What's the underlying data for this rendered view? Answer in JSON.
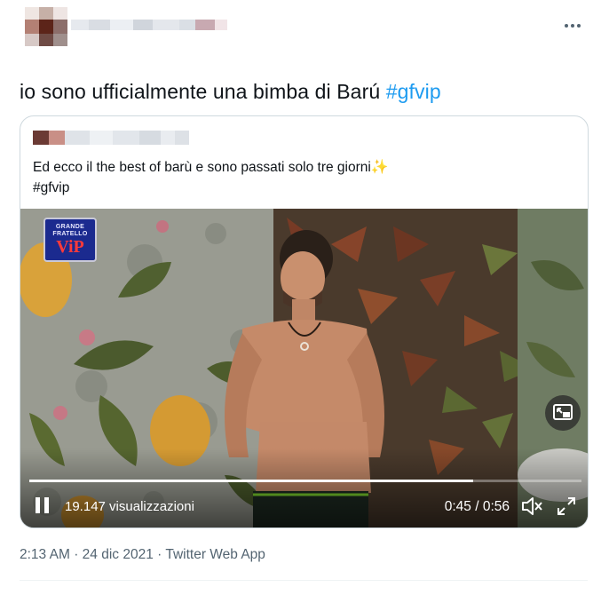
{
  "tweet": {
    "text_plain": "io sono ufficialmente una bimba di Barú",
    "hashtag": "#gfvip"
  },
  "quote": {
    "line1": "Ed ecco il the best of barù e sono passati solo tre giorni",
    "sparkle": "✨",
    "line2": "#gfvip"
  },
  "video": {
    "logo_small": "GRANDE FRATELLO",
    "logo_big": "ViP",
    "views": "19.147 visualizzazioni",
    "time": "0:45 / 0:56",
    "progress": 0.8036
  },
  "footer": {
    "time": "2:13 AM",
    "date": "24 dic 2021",
    "source": "Twitter Web App",
    "sep": "·"
  },
  "icons": {
    "more": "more-horizontal-icon",
    "pause": "pause-icon",
    "mute": "volume-muted-icon",
    "fullscreen": "fullscreen-icon",
    "pip": "picture-in-picture-icon"
  },
  "colors": {
    "accent": "#1d9bf0",
    "text": "#0f1419",
    "muted": "#536471",
    "border": "#cfd9de"
  }
}
